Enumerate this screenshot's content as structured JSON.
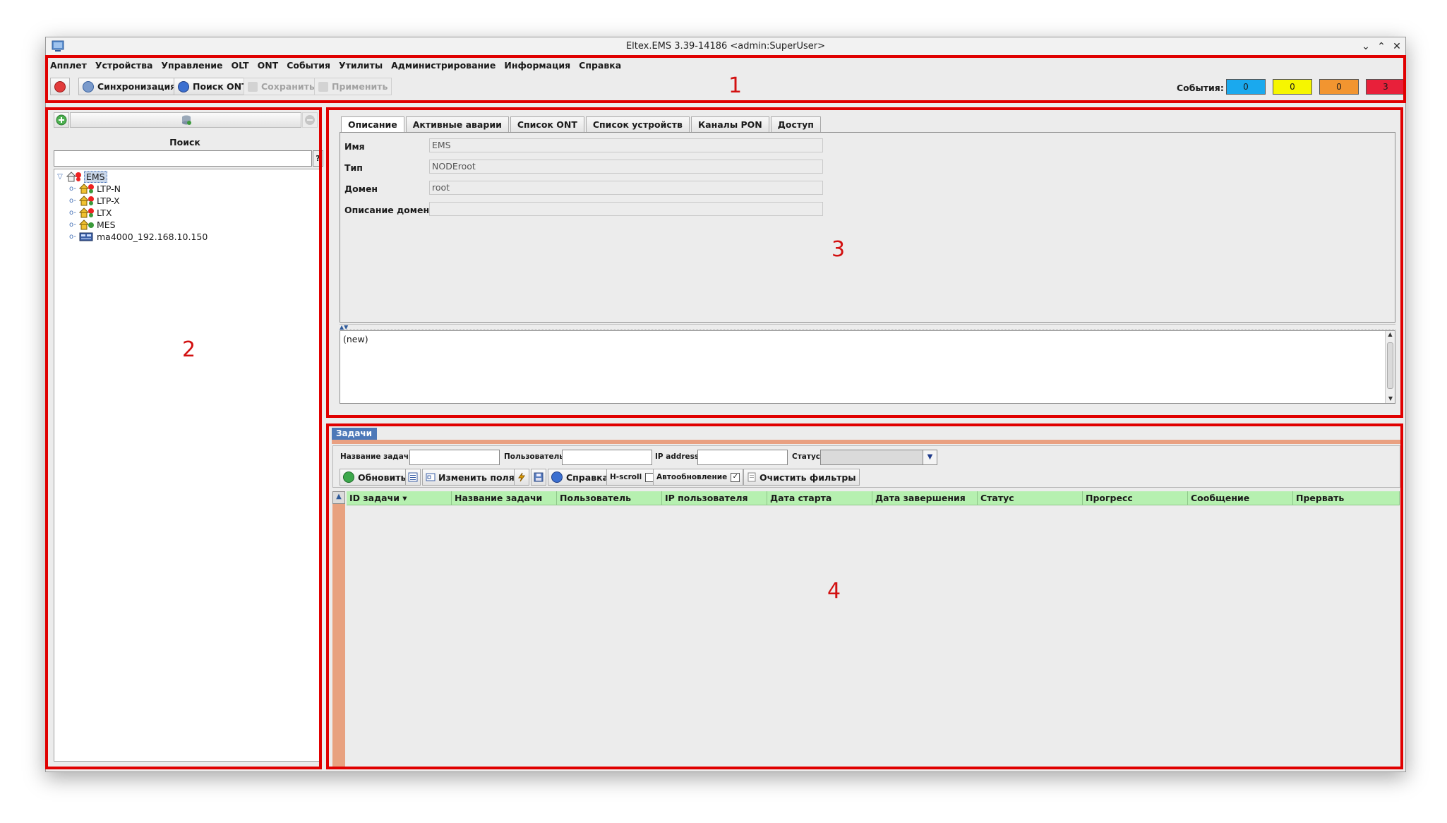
{
  "window": {
    "title": "Eltex.EMS 3.39-14186 <admin:SuperUser>"
  },
  "menu": [
    "Апплет",
    "Устройства",
    "Управление",
    "OLT",
    "ONT",
    "События",
    "Утилиты",
    "Администрирование",
    "Информация",
    "Справка"
  ],
  "toolbar": {
    "sync": "Синхронизация",
    "search_ont": "Поиск ONT",
    "save": "Сохранить",
    "apply": "Применить"
  },
  "events": {
    "label": "События:",
    "counts": [
      "0",
      "0",
      "0",
      "3"
    ],
    "colors": [
      "#1aa9ee",
      "#f6f600",
      "#f29530",
      "#e8203a"
    ]
  },
  "annotations": [
    "1",
    "2",
    "3",
    "4"
  ],
  "sidebar": {
    "search_label": "Поиск",
    "help": "?",
    "tree": [
      {
        "label": "EMS",
        "level": 0
      },
      {
        "label": "LTP-N",
        "level": 1
      },
      {
        "label": "LTP-X",
        "level": 1
      },
      {
        "label": "LTX",
        "level": 1
      },
      {
        "label": "MES",
        "level": 1
      },
      {
        "label": "ma4000_192.168.10.150",
        "level": 1
      }
    ]
  },
  "details": {
    "tabs": [
      "Описание",
      "Активные аварии",
      "Список ONT",
      "Список устройств",
      "Каналы PON",
      "Доступ"
    ],
    "fields": [
      {
        "label": "Имя",
        "value": "EMS"
      },
      {
        "label": "Тип",
        "value": "NODEroot"
      },
      {
        "label": "Домен",
        "value": "root"
      },
      {
        "label": "Описание домена",
        "value": ""
      }
    ],
    "description": "(new)"
  },
  "tasks": {
    "tab": "Задачи",
    "filters": {
      "task_name": "Название задачи:",
      "user": "Пользователь:",
      "ip": "IP address:",
      "status": "Статус:"
    },
    "buttons": {
      "refresh": "Обновить",
      "edit_fields": "Изменить поля",
      "help": "Справка",
      "hscroll": "H-scroll",
      "autorefresh": "Автообновление",
      "autorefresh_check": "✓",
      "clear_filters": "Очистить фильтры"
    },
    "columns": [
      "ID задачи ▾",
      "Название задачи",
      "Пользователь",
      "IP пользователя",
      "Дата старта",
      "Дата завершения",
      "Статус",
      "Прогресс",
      "Сообщение",
      "Прервать"
    ]
  }
}
